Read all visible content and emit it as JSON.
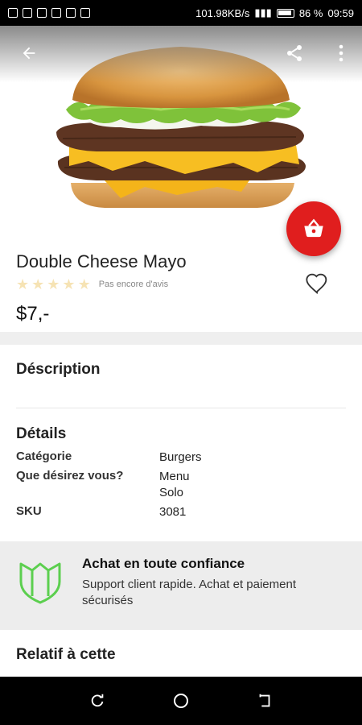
{
  "status_bar": {
    "network_speed": "101.98KB/s",
    "battery": "86 %",
    "time": "09:59"
  },
  "product": {
    "name": "Double Cheese Mayo",
    "rating_stars": 5,
    "rating_value": 0,
    "review_text": "Pas encore d'avis",
    "price": "$7,-"
  },
  "description": {
    "title": "Déscription"
  },
  "details": {
    "title": "Détails",
    "rows": [
      {
        "label": "Catégorie",
        "value": "Burgers"
      },
      {
        "label": "Que désirez vous?",
        "value": "Menu\nSolo"
      },
      {
        "label": "SKU",
        "value": "3081"
      }
    ]
  },
  "trust": {
    "title": "Achat en toute confiance",
    "subtitle": "Support client rapide. Achat et paiement sécurisés"
  },
  "related": {
    "title": "Relatif à cette"
  },
  "colors": {
    "accent_red": "#e01e1e",
    "shield_green": "#5ccf4f",
    "star_empty": "#f6e3b4"
  },
  "icons": {
    "back": "arrow-back-icon",
    "share": "share-icon",
    "more": "more-vert-icon",
    "cart": "basket-icon",
    "favorite": "heart-outline-icon",
    "trust": "shield-icon"
  }
}
